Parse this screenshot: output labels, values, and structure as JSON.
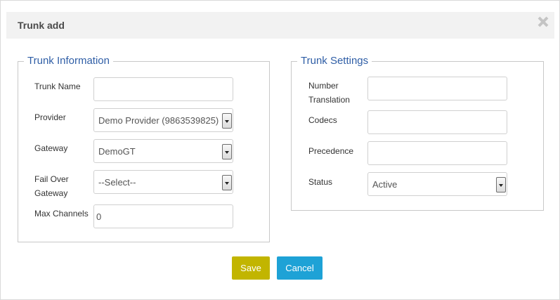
{
  "dialog": {
    "title": "Trunk add",
    "close_icon": "close-icon"
  },
  "trunk_information": {
    "legend": "Trunk Information",
    "fields": {
      "trunk_name": {
        "label": "Trunk Name",
        "value": ""
      },
      "provider": {
        "label": "Provider",
        "value": "Demo Provider (9863539825)"
      },
      "gateway": {
        "label": "Gateway",
        "value": "DemoGT"
      },
      "fail_over_gateway": {
        "label_line1": "Fail Over",
        "label_line2": "Gateway",
        "value": "--Select--"
      },
      "max_channels": {
        "label": "Max Channels",
        "value": "0"
      }
    }
  },
  "trunk_settings": {
    "legend": "Trunk Settings",
    "fields": {
      "number_translation": {
        "label_line1": "Number",
        "label_line2": "Translation",
        "value": ""
      },
      "codecs": {
        "label": "Codecs",
        "value": ""
      },
      "precedence": {
        "label": "Precedence",
        "value": ""
      },
      "status": {
        "label": "Status",
        "value": "Active"
      }
    }
  },
  "actions": {
    "save_label": "Save",
    "cancel_label": "Cancel"
  },
  "colors": {
    "legend": "#2f5ea6",
    "save_button": "#c2b500",
    "cancel_button": "#1ea2d6",
    "header_bg": "#f2f2f2"
  }
}
